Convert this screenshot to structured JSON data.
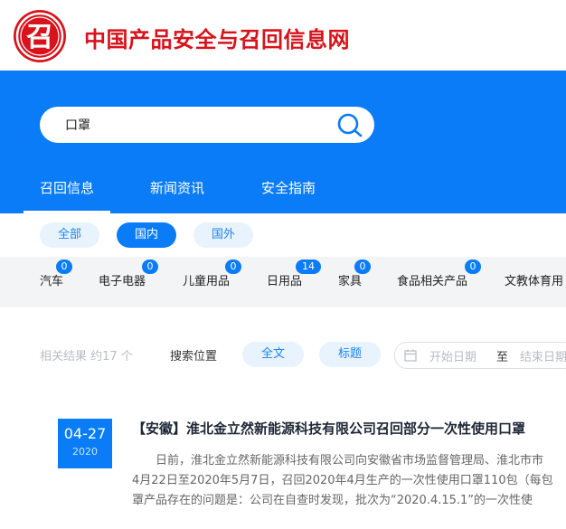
{
  "site": {
    "logo_glyph": "召",
    "title": "中国产品安全与召回信息网",
    "brand_color": "#d8131b"
  },
  "search": {
    "value": "口罩",
    "icon": "search-icon"
  },
  "tabs": [
    {
      "label": "召回信息",
      "active": true
    },
    {
      "label": "新闻资讯",
      "active": false
    },
    {
      "label": "安全指南",
      "active": false
    }
  ],
  "region_filter": [
    {
      "label": "全部",
      "active": false
    },
    {
      "label": "国内",
      "active": true
    },
    {
      "label": "国外",
      "active": false
    }
  ],
  "categories": [
    {
      "label": "汽车",
      "count": "0"
    },
    {
      "label": "电子电器",
      "count": "0"
    },
    {
      "label": "儿童用品",
      "count": "0"
    },
    {
      "label": "日用品",
      "count": "14"
    },
    {
      "label": "家具",
      "count": "0"
    },
    {
      "label": "食品相关产品",
      "count": "0"
    },
    {
      "label": "文教体育用",
      "count": ""
    }
  ],
  "filter": {
    "result_count": "相关结果 约17 个",
    "search_position_label": "搜索位置",
    "fulltext_label": "全文",
    "title_label": "标题",
    "start_date_placeholder": "开始日期",
    "to_label": "至",
    "end_date_placeholder": "结束日期"
  },
  "results": [
    {
      "date_md": "04-27",
      "year": "2020",
      "title": "【安徽】淮北金立然新能源科技有限公司召回部分一次性使用口罩",
      "lines": [
        "日前，淮北金立然新能源科技有限公司向安徽省市场监督管理局、淮北市市",
        "4月22日至2020年5月7日，召回2020年4月生产的一次性使用口罩110包（每包",
        "罩产品存在的问题是：公司在自查时发现，批次为“2020.4.15.1”的一次性使"
      ]
    }
  ],
  "colors": {
    "accent": "#0a7cf8",
    "pill_bg": "#e8f3fe",
    "category_bg": "#f3f4f6"
  }
}
